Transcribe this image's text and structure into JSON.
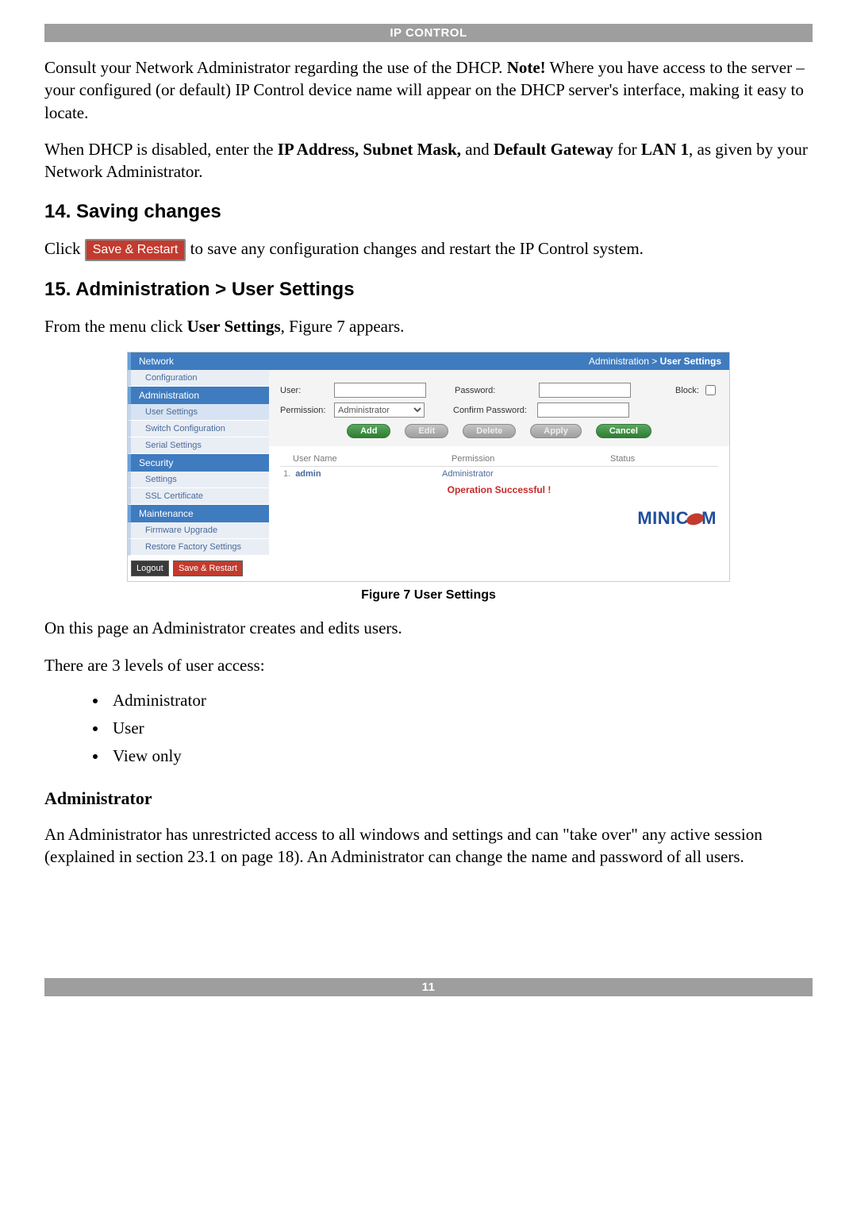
{
  "header": {
    "title": "IP CONTROL"
  },
  "footer": {
    "page": "11"
  },
  "paragraphs": {
    "p1a": "Consult your Network Administrator regarding the use of the DHCP. ",
    "p1_note": "Note!",
    "p1b": " Where you have access to the server – your configured (or default) IP Control device name will appear on the DHCP server's interface, making it easy to locate.",
    "p2a": "When DHCP is disabled, enter the ",
    "p2b": "IP Address, Subnet Mask,",
    "p2c": " and ",
    "p2d": "Default Gateway",
    "p2e": " for ",
    "p2f": "LAN 1",
    "p2g": ", as given by your Network Administrator.",
    "sec14": "14. Saving changes",
    "p3a": "Click ",
    "p3btn": "Save & Restart",
    "p3b": " to save any configuration changes and restart the IP Control system.",
    "sec15": "15. Administration > User Settings",
    "p4a": "From the menu click ",
    "p4b": "User Settings",
    "p4c": ", Figure 7 appears.",
    "figcap": "Figure 7 User Settings",
    "p5": "On this page an Administrator creates and edits users.",
    "p6": "There are 3 levels of user access:",
    "bullets": [
      "Administrator",
      "User",
      "View only"
    ],
    "sub_admin": "Administrator",
    "p7": "An Administrator has unrestricted access to all windows and settings and can \"take over\" any active session (explained in section 23.1 on page 18). An Administrator can change the name and password of all users."
  },
  "ui": {
    "sidebar": {
      "sections": [
        {
          "head": "Network",
          "items": [
            "Configuration"
          ]
        },
        {
          "head": "Administration",
          "items": [
            "User Settings",
            "Switch Configuration",
            "Serial Settings"
          ]
        },
        {
          "head": "Security",
          "items": [
            "Settings",
            "SSL Certificate"
          ]
        },
        {
          "head": "Maintenance",
          "items": [
            "Firmware Upgrade",
            "Restore Factory Settings"
          ]
        }
      ],
      "logout": "Logout",
      "save_restart": "Save & Restart"
    },
    "breadcrumb": {
      "section": "Administration",
      "sep": " > ",
      "page": "User Settings"
    },
    "form": {
      "user_label": "User:",
      "password_label": "Password:",
      "block_label": "Block:",
      "permission_label": "Permission:",
      "permission_value": "Administrator",
      "confirm_label": "Confirm Password:",
      "buttons": {
        "add": "Add",
        "edit": "Edit",
        "delete": "Delete",
        "apply": "Apply",
        "cancel": "Cancel"
      }
    },
    "table": {
      "headers": [
        "User Name",
        "Permission",
        "Status"
      ],
      "rows": [
        {
          "idx": "1.",
          "name": "admin",
          "permission": "Administrator",
          "status": ""
        }
      ],
      "message": "Operation Successful !"
    },
    "brand": {
      "left": "MINIC",
      "right": "M"
    }
  }
}
